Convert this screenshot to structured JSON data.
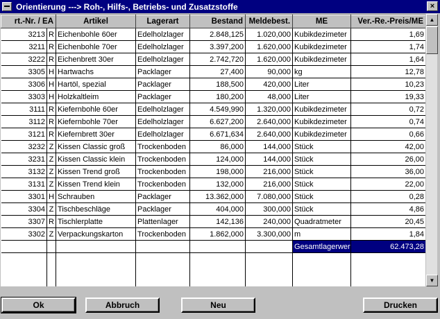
{
  "window": {
    "title": "Orientierung   ---> Roh-, Hilfs-, Betriebs- und Zusatzstoffe",
    "close_glyph": "×"
  },
  "table": {
    "headers": {
      "artnr": "rt.-Nr. / EA",
      "artikel": "Artikel",
      "lagerart": "Lagerart",
      "bestand": "Bestand",
      "meldebest": "Meldebest.",
      "me": "ME",
      "preis": "Ver.-Re.-Preis/ME"
    },
    "rows": [
      {
        "artnr": "3213",
        "ea": "R",
        "artikel": "Eichenbohle 60er",
        "lagerart": "Edelholzlager",
        "bestand": "2.848,125",
        "meldebest": "1.020,000",
        "me": "Kubikdezimeter",
        "preis": "1,69"
      },
      {
        "artnr": "3211",
        "ea": "R",
        "artikel": "Eichenbohle 70er",
        "lagerart": "Edelholzlager",
        "bestand": "3.397,200",
        "meldebest": "1.620,000",
        "me": "Kubikdezimeter",
        "preis": "1,74"
      },
      {
        "artnr": "3222",
        "ea": "R",
        "artikel": "Eichenbrett 30er",
        "lagerart": "Edelholzlager",
        "bestand": "2.742,720",
        "meldebest": "1.620,000",
        "me": "Kubikdezimeter",
        "preis": "1,64"
      },
      {
        "artnr": "3305",
        "ea": "H",
        "artikel": "Hartwachs",
        "lagerart": "Packlager",
        "bestand": "27,400",
        "meldebest": "90,000",
        "me": "kg",
        "preis": "12,78"
      },
      {
        "artnr": "3306",
        "ea": "H",
        "artikel": "Hartöl, spezial",
        "lagerart": "Packlager",
        "bestand": "188,500",
        "meldebest": "420,000",
        "me": "Liter",
        "preis": "10,23"
      },
      {
        "artnr": "3303",
        "ea": "H",
        "artikel": "Holzkaltleim",
        "lagerart": "Packlager",
        "bestand": "180,200",
        "meldebest": "48,000",
        "me": "Liter",
        "preis": "19,33"
      },
      {
        "artnr": "3111",
        "ea": "R",
        "artikel": "Kiefernbohle 60er",
        "lagerart": "Edelholzlager",
        "bestand": "4.549,990",
        "meldebest": "1.320,000",
        "me": "Kubikdezimeter",
        "preis": "0,72"
      },
      {
        "artnr": "3112",
        "ea": "R",
        "artikel": "Kiefernbohle 70er",
        "lagerart": "Edelholzlager",
        "bestand": "6.627,200",
        "meldebest": "2.640,000",
        "me": "Kubikdezimeter",
        "preis": "0,74"
      },
      {
        "artnr": "3121",
        "ea": "R",
        "artikel": "Kiefernbrett 30er",
        "lagerart": "Edelholzlager",
        "bestand": "6.671,634",
        "meldebest": "2.640,000",
        "me": "Kubikdezimeter",
        "preis": "0,66"
      },
      {
        "artnr": "3232",
        "ea": "Z",
        "artikel": "Kissen Classic groß",
        "lagerart": "Trockenboden",
        "bestand": "86,000",
        "meldebest": "144,000",
        "me": "Stück",
        "preis": "42,00"
      },
      {
        "artnr": "3231",
        "ea": "Z",
        "artikel": "Kissen Classic klein",
        "lagerart": "Trockenboden",
        "bestand": "124,000",
        "meldebest": "144,000",
        "me": "Stück",
        "preis": "26,00"
      },
      {
        "artnr": "3132",
        "ea": "Z",
        "artikel": "Kissen Trend groß",
        "lagerart": "Trockenboden",
        "bestand": "198,000",
        "meldebest": "216,000",
        "me": "Stück",
        "preis": "36,00"
      },
      {
        "artnr": "3131",
        "ea": "Z",
        "artikel": "Kissen Trend klein",
        "lagerart": "Trockenboden",
        "bestand": "132,000",
        "meldebest": "216,000",
        "me": "Stück",
        "preis": "22,00"
      },
      {
        "artnr": "3301",
        "ea": "H",
        "artikel": "Schrauben",
        "lagerart": "Packlager",
        "bestand": "13.362,000",
        "meldebest": "7.080,000",
        "me": "Stück",
        "preis": "0,28"
      },
      {
        "artnr": "3304",
        "ea": "Z",
        "artikel": "Tischbeschläge",
        "lagerart": "Packlager",
        "bestand": "404,000",
        "meldebest": "300,000",
        "me": "Stück",
        "preis": "4,86"
      },
      {
        "artnr": "3307",
        "ea": "R",
        "artikel": "Tischlerplatte",
        "lagerart": "Plattenlager",
        "bestand": "142,136",
        "meldebest": "240,000",
        "me": "Quadratmeter",
        "preis": "20,45"
      },
      {
        "artnr": "3302",
        "ea": "Z",
        "artikel": "Verpackungskarton",
        "lagerart": "Trockenboden",
        "bestand": "1.862,000",
        "meldebest": "3.300,000",
        "me": "m",
        "preis": "1,84"
      }
    ],
    "total": {
      "label": "Gesamtlagerwert",
      "value": "62.473,28"
    }
  },
  "scrollbar": {
    "up_glyph": "▲",
    "down_glyph": "▼"
  },
  "buttons": {
    "ok": "Ok",
    "abbruch": "Abbruch",
    "neu": "Neu",
    "drucken": "Drucken"
  }
}
